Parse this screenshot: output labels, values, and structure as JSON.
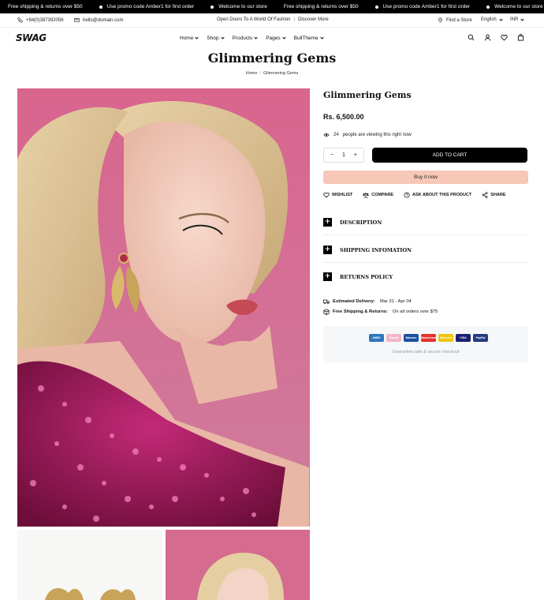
{
  "announcement": {
    "messages": [
      "Free shipping & returns over $50",
      "Use promo code Amber1 for first order",
      "Welcome to our store",
      "Free shipping & returns over $50",
      "Use promo code Amber1 for first order",
      "Welcome to our store"
    ]
  },
  "topbar": {
    "phone": "+84(0)387392056",
    "email": "hello@domain.com",
    "promo": "Open Doors To A World Of Fashion",
    "promo_link": "Discover More",
    "find_store": "Find a Store",
    "language": "English",
    "currency": "INR"
  },
  "header": {
    "logo": "SWAG",
    "nav": [
      "Home",
      "Shop",
      "Products",
      "Pages",
      "BullTheme"
    ]
  },
  "page": {
    "title": "Glimmering Gems",
    "breadcrumb": [
      "Home",
      "Glimmering Gems"
    ]
  },
  "product": {
    "name": "Glimmering Gems",
    "price": "Rs. 6,500.00",
    "viewers": "24",
    "viewers_text": "people are viewing this right now",
    "quantity": "1",
    "add_to_cart": "ADD TO CART",
    "buy_now": "Buy it now",
    "actions": [
      "WISHLIST",
      "COMPARE",
      "ASK ABOUT THIS PRODUCT",
      "SHARE"
    ],
    "accordions": [
      "DESCRIPTION",
      "SHIPPING INFOMATION",
      "RETURNS POLICY"
    ],
    "delivery_label": "Estimated Delivery:",
    "delivery_value": "Mar 31 - Apr 04",
    "shipping_label": "Free Shipping & Returns:",
    "shipping_value": "On all orders over $75",
    "payment_cards": [
      {
        "name": "AMEX",
        "color": "#2e77bb"
      },
      {
        "name": "Klarna",
        "color": "#f4b6c7"
      },
      {
        "name": "Maestro",
        "color": "#1d4fa1"
      },
      {
        "name": "Mastercard",
        "color": "#e2322c"
      },
      {
        "name": "Discover",
        "color": "#f1c40f"
      },
      {
        "name": "VISA",
        "color": "#1a1f71"
      },
      {
        "name": "PayPal",
        "color": "#253b80"
      }
    ],
    "guarantee": "Guarantee safe & secure checkout"
  },
  "colors": {
    "brand": "#000000",
    "buy_now_bg": "#f7c7b7",
    "photo_backdrop": "#d8658d",
    "sequin_dress": "#a8165e"
  }
}
